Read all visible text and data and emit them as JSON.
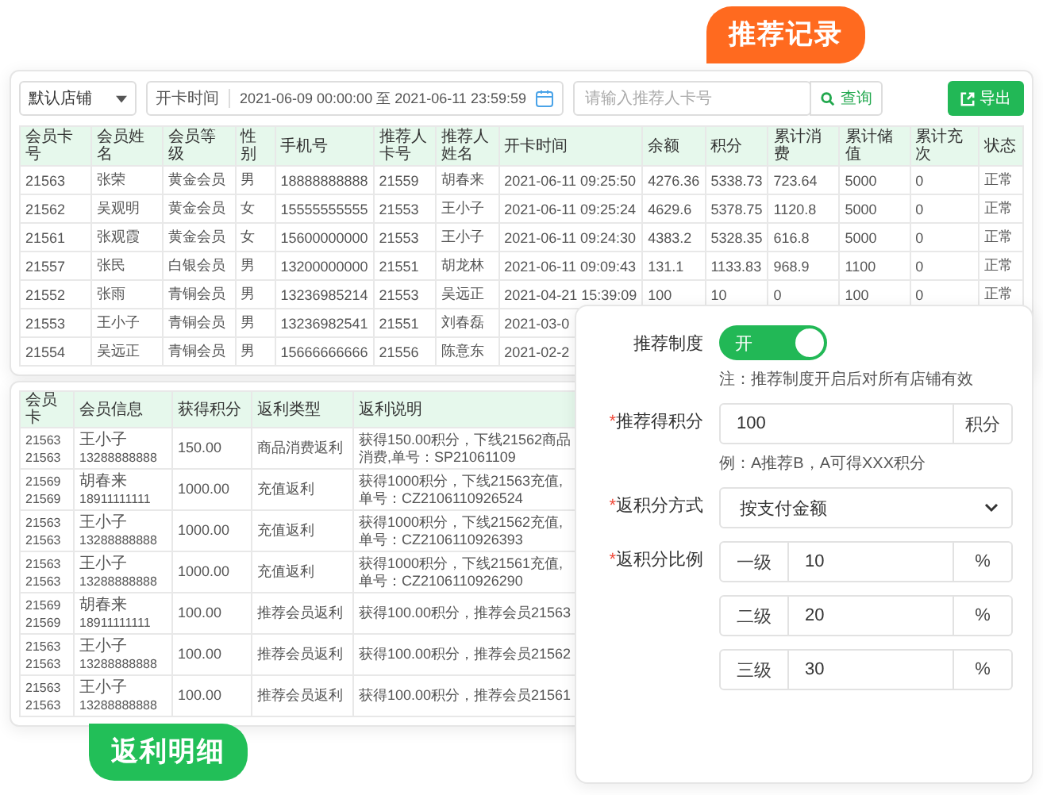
{
  "badges": [
    {
      "label": "推荐记录",
      "color": "#ff6a1f"
    },
    {
      "label": "返利明细",
      "color": "#22bf58"
    }
  ],
  "member_table": {
    "store_select": "默认店铺",
    "date_label": "开卡时间",
    "date_range": "2021-06-09 00:00:00 至 2021-06-11 23:59:59",
    "search": {
      "placeholder": "请输入推荐人卡号"
    },
    "search_button": "查询",
    "export_button": "导出",
    "columns": [
      "会员卡号",
      "会员姓名",
      "会员等级",
      "性别",
      "手机号",
      "推荐人卡号",
      "推荐人姓名",
      "开卡时间",
      "余额",
      "积分",
      "累计消费",
      "累计储值",
      "累计充次",
      "状态"
    ],
    "rows": [
      {
        "cells": [
          "21563",
          "张荣",
          "黄金会员",
          "男",
          "18888888888",
          "21559",
          "胡春来",
          "2021-06-11 09:25:50",
          "4276.36",
          "5338.73",
          "723.64",
          "5000",
          "0",
          "正常"
        ]
      },
      {
        "cells": [
          "21562",
          "吴观明",
          "黄金会员",
          "女",
          "15555555555",
          "21553",
          "王小子",
          "2021-06-11 09:25:24",
          "4629.6",
          "5378.75",
          "1120.8",
          "5000",
          "0",
          "正常"
        ]
      },
      {
        "cells": [
          "21561",
          "张观霞",
          "黄金会员",
          "女",
          "15600000000",
          "21553",
          "王小子",
          "2021-06-11 09:24:30",
          "4383.2",
          "5328.35",
          "616.8",
          "5000",
          "0",
          "正常"
        ]
      },
      {
        "cells": [
          "21557",
          "张民",
          "白银会员",
          "男",
          "13200000000",
          "21551",
          "胡龙林",
          "2021-06-11 09:09:43",
          "131.1",
          "1133.83",
          "968.9",
          "1100",
          "0",
          "正常"
        ]
      },
      {
        "cells": [
          "21552",
          "张雨",
          "青铜会员",
          "男",
          "13236985214",
          "21553",
          "吴远正",
          "2021-04-21 15:39:09",
          "100",
          "10",
          "0",
          "100",
          "0",
          "正常"
        ]
      },
      {
        "cells": [
          "21553",
          "王小子",
          "青铜会员",
          "男",
          "13236982541",
          "21551",
          "刘春磊",
          "2021-03-0"
        ]
      },
      {
        "cells": [
          "21554",
          "吴远正",
          "青铜会员",
          "男",
          "15666666666",
          "21556",
          "陈意东",
          "2021-02-2"
        ]
      }
    ]
  },
  "rebate_table": {
    "columns": [
      "会员卡",
      "会员信息",
      "获得积分",
      "返利类型",
      "返利说明"
    ],
    "rows": [
      {
        "card": [
          "21563",
          "21563"
        ],
        "name": "王小子",
        "phone": "13288888888",
        "points": "150.00",
        "type": "商品消费返利",
        "desc": "获得150.00积分，下线21562商品消费,单号：SP21061109"
      },
      {
        "card": [
          "21569",
          "21569"
        ],
        "name": "胡春来",
        "phone": "18911111111",
        "points": "1000.00",
        "type": "充值返利",
        "desc": "获得1000积分，下线21563充值,单号：CZ2106110926524"
      },
      {
        "card": [
          "21563",
          "21563"
        ],
        "name": "王小子",
        "phone": "13288888888",
        "points": "1000.00",
        "type": "充值返利",
        "desc": "获得1000积分，下线21562充值,单号：CZ2106110926393"
      },
      {
        "card": [
          "21563",
          "21563"
        ],
        "name": "王小子",
        "phone": "13288888888",
        "points": "1000.00",
        "type": "充值返利",
        "desc": "获得1000积分，下线21561充值,单号：CZ2106110926290"
      },
      {
        "card": [
          "21569",
          "21569"
        ],
        "name": "胡春来",
        "phone": "18911111111",
        "points": "100.00",
        "type": "推荐会员返利",
        "desc": "获得100.00积分，推荐会员21563"
      },
      {
        "card": [
          "21563",
          "21563"
        ],
        "name": "王小子",
        "phone": "13288888888",
        "points": "100.00",
        "type": "推荐会员返利",
        "desc": "获得100.00积分，推荐会员21562"
      },
      {
        "card": [
          "21563",
          "21563"
        ],
        "name": "王小子",
        "phone": "13288888888",
        "points": "100.00",
        "type": "推荐会员返利",
        "desc": "获得100.00积分，推荐会员21561"
      }
    ]
  },
  "settings": {
    "recommend": {
      "label": "推荐制度",
      "text": "开",
      "on": true
    },
    "note": "注：推荐制度开启后对所有店铺有效",
    "points": {
      "mark": "*",
      "label": "推荐得积分",
      "value": "100",
      "unit": "积分"
    },
    "hint": "例：A推荐B，A可得XXX积分",
    "method": {
      "mark": "*",
      "label": "返积分方式",
      "value": "按支付金额"
    },
    "ratio": {
      "mark": "*",
      "label": "返积分比例",
      "levels": [
        {
          "label": "一级",
          "value": "10",
          "unit": "%"
        },
        {
          "label": "二级",
          "value": "20",
          "unit": "%"
        },
        {
          "label": "三级",
          "value": "30",
          "unit": "%"
        }
      ]
    }
  }
}
